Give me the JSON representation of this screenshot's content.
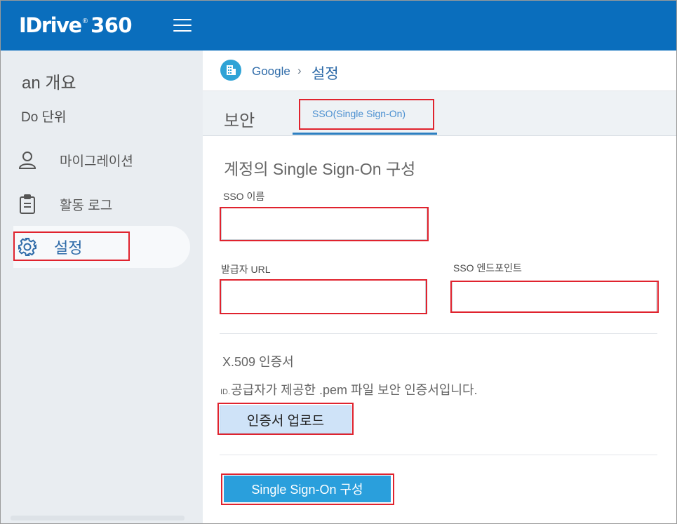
{
  "header": {
    "logo_text": "IDrive",
    "logo_reg": "®",
    "logo_num": "360",
    "brand_color": "#0a6ebd"
  },
  "sidebar": {
    "heading1": "an 개요",
    "heading2": "Do 단위",
    "items": [
      {
        "label": "마이그레이션",
        "icon": "user-icon"
      },
      {
        "label": "활동 로그",
        "icon": "clipboard-icon"
      },
      {
        "label": "설정",
        "icon": "gear-icon",
        "active": true
      }
    ]
  },
  "breadcrumb": {
    "icon": "building-icon",
    "link": "Google",
    "separator": "›",
    "current": "설정"
  },
  "tabs": {
    "security": "보안",
    "sso": "SSO(Single Sign-On)"
  },
  "form": {
    "title": "계정의 Single Sign-On 구성",
    "sso_name_label": "SSO 이름",
    "issuer_url_label": "발급자 URL",
    "sso_endpoint_label": "SSO 엔드포인트",
    "sso_name_value": "",
    "issuer_url_value": "",
    "sso_endpoint_value": ""
  },
  "certificate": {
    "title": "X.509 인증서",
    "desc_prefix": "ID.",
    "desc": "공급자가 제공한 .pem 파일 보안 인증서입니다.",
    "upload_label": "인증서 업로드"
  },
  "actions": {
    "configure_label": "Single Sign-On 구성"
  },
  "colors": {
    "accent": "#2a9fdc",
    "highlight": "#e0232e",
    "sidebar_bg": "#e9edf1"
  }
}
